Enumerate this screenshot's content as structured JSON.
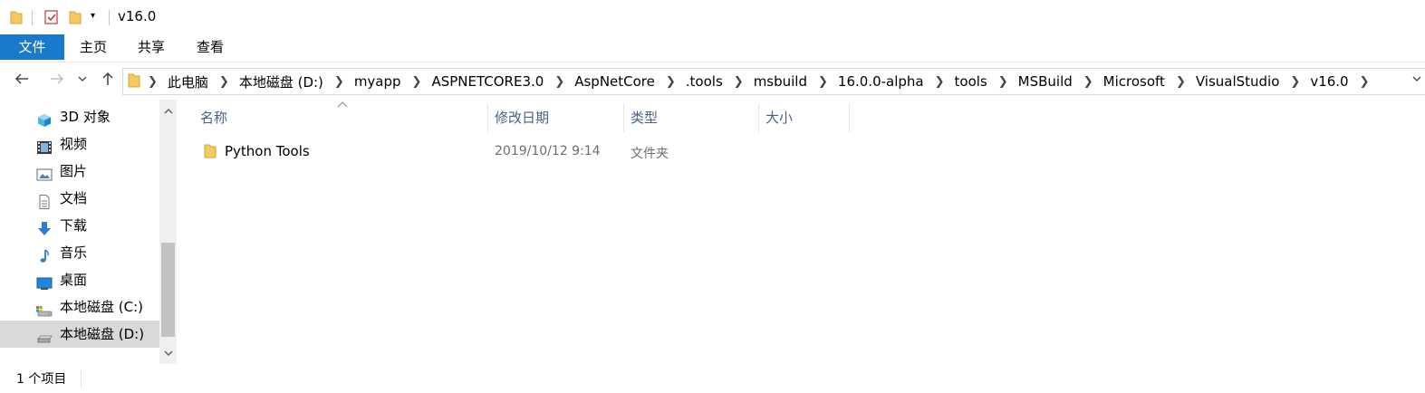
{
  "window": {
    "title": "v16.0",
    "quick_access": [
      "folder-icon",
      "properties-icon",
      "new-folder-icon",
      "customize-dropdown-icon"
    ]
  },
  "ribbon": {
    "tabs": [
      {
        "label": "文件",
        "active": true
      },
      {
        "label": "主页"
      },
      {
        "label": "共享"
      },
      {
        "label": "查看"
      }
    ]
  },
  "address": {
    "crumbs": [
      "此电脑",
      "本地磁盘 (D:)",
      "myapp",
      "ASPNETCORE3.0",
      "AspNetCore",
      ".tools",
      "msbuild",
      "16.0.0-alpha",
      "tools",
      "MSBuild",
      "Microsoft",
      "VisualStudio",
      "v16.0"
    ]
  },
  "nav": {
    "items": [
      {
        "label": "3D 对象",
        "icon": "3d-objects-icon"
      },
      {
        "label": "视频",
        "icon": "videos-icon"
      },
      {
        "label": "图片",
        "icon": "pictures-icon"
      },
      {
        "label": "文档",
        "icon": "documents-icon"
      },
      {
        "label": "下载",
        "icon": "downloads-icon"
      },
      {
        "label": "音乐",
        "icon": "music-icon"
      },
      {
        "label": "桌面",
        "icon": "desktop-icon"
      },
      {
        "label": "本地磁盘 (C:)",
        "icon": "drive-c-icon"
      },
      {
        "label": "本地磁盘 (D:)",
        "icon": "drive-d-icon",
        "selected": true
      }
    ]
  },
  "columns": {
    "name": "名称",
    "modified": "修改日期",
    "type": "类型",
    "size": "大小"
  },
  "files": [
    {
      "name": "Python Tools",
      "modified": "2019/10/12 9:14",
      "type": "文件夹",
      "size": ""
    }
  ],
  "status": {
    "count": "1 个项目"
  },
  "colors": {
    "accent": "#1979ca",
    "selection": "#d9d9d9",
    "folder": "#f4c95d",
    "header_text": "#4d6082"
  }
}
